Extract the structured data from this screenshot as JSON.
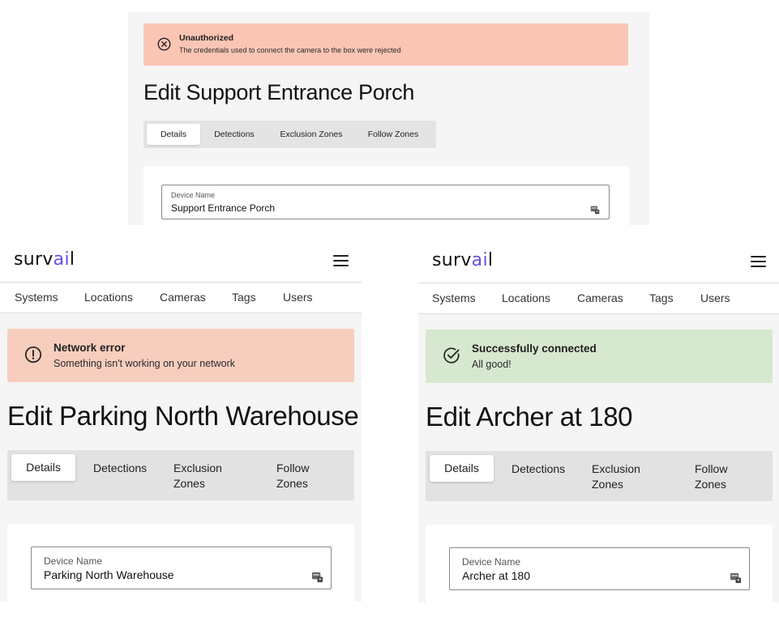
{
  "top": {
    "alert": {
      "title": "Unauthorized",
      "message": "The credentials used to connect the camera to the box were rejected",
      "icon": "x-circle-icon",
      "color": "#fbc5b4"
    },
    "page_title": "Edit Support Entrance Porch",
    "tabs": [
      {
        "label": "Details",
        "active": true
      },
      {
        "label": "Detections"
      },
      {
        "label": "Exclusion Zones"
      },
      {
        "label": "Follow Zones"
      }
    ],
    "field": {
      "label": "Device Name",
      "value": "Support Entrance Porch"
    }
  },
  "left": {
    "brand": {
      "pre": "surv",
      "accent": "ai",
      "post": "l",
      "accent_color": "#6b4fe6"
    },
    "nav": [
      "Systems",
      "Locations",
      "Cameras",
      "Tags",
      "Users"
    ],
    "alert": {
      "title": "Network error",
      "message": "Something isn't working on your network",
      "icon": "exclamation-circle-icon",
      "color": "#f7cebd"
    },
    "page_title": "Edit Parking North Warehouse",
    "tabs": [
      {
        "label": "Details",
        "active": true
      },
      {
        "label": "Detections"
      },
      {
        "label": "Exclusion Zones"
      },
      {
        "label": "Follow Zones"
      }
    ],
    "field": {
      "label": "Device Name",
      "value": "Parking North Warehouse"
    }
  },
  "right": {
    "brand": {
      "pre": "surv",
      "accent": "ai",
      "post": "l",
      "accent_color": "#6b4fe6"
    },
    "nav": [
      "Systems",
      "Locations",
      "Cameras",
      "Tags",
      "Users"
    ],
    "alert": {
      "title": "Successfully connected",
      "message": "All good!",
      "icon": "check-circle-icon",
      "color": "#d6e8cf"
    },
    "page_title": "Edit Archer at 180",
    "tabs": [
      {
        "label": "Details",
        "active": true
      },
      {
        "label": "Detections"
      },
      {
        "label": "Exclusion Zones"
      },
      {
        "label": "Follow Zones"
      }
    ],
    "field": {
      "label": "Device Name",
      "value": "Archer at 180"
    }
  }
}
